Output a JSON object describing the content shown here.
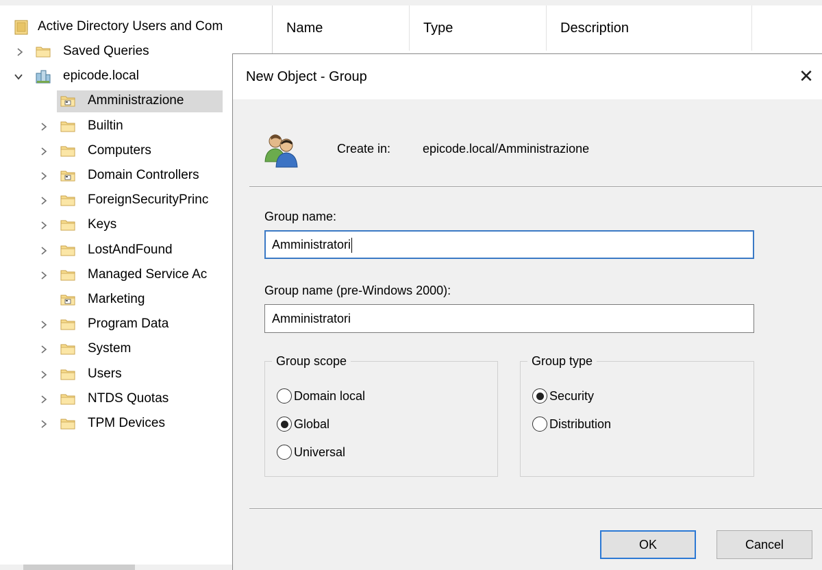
{
  "tree": {
    "root_label": "Active Directory Users and Com",
    "items": [
      {
        "label": "Saved Queries",
        "level": 1,
        "expand": "collapsed",
        "icon": "folder-icon"
      },
      {
        "label": "epicode.local",
        "level": 1,
        "expand": "expanded",
        "icon": "domain-icon"
      },
      {
        "label": "Amministrazione",
        "level": 2,
        "expand": "none",
        "icon": "ou-folder-icon",
        "selected": true
      },
      {
        "label": "Builtin",
        "level": 2,
        "expand": "collapsed",
        "icon": "folder-icon"
      },
      {
        "label": "Computers",
        "level": 2,
        "expand": "collapsed",
        "icon": "folder-icon"
      },
      {
        "label": "Domain Controllers",
        "level": 2,
        "expand": "collapsed",
        "icon": "ou-folder-icon"
      },
      {
        "label": "ForeignSecurityPrinc",
        "level": 2,
        "expand": "collapsed",
        "icon": "folder-icon"
      },
      {
        "label": "Keys",
        "level": 2,
        "expand": "collapsed",
        "icon": "folder-icon"
      },
      {
        "label": "LostAndFound",
        "level": 2,
        "expand": "collapsed",
        "icon": "folder-icon"
      },
      {
        "label": "Managed Service Ac",
        "level": 2,
        "expand": "collapsed",
        "icon": "folder-icon"
      },
      {
        "label": "Marketing",
        "level": 2,
        "expand": "none",
        "icon": "ou-folder-icon"
      },
      {
        "label": "Program Data",
        "level": 2,
        "expand": "collapsed",
        "icon": "folder-icon"
      },
      {
        "label": "System",
        "level": 2,
        "expand": "collapsed",
        "icon": "folder-icon"
      },
      {
        "label": "Users",
        "level": 2,
        "expand": "collapsed",
        "icon": "folder-icon"
      },
      {
        "label": "NTDS Quotas",
        "level": 2,
        "expand": "collapsed",
        "icon": "folder-icon"
      },
      {
        "label": "TPM Devices",
        "level": 2,
        "expand": "collapsed",
        "icon": "folder-icon"
      }
    ]
  },
  "list": {
    "columns": [
      "Name",
      "Type",
      "Description",
      ""
    ]
  },
  "dialog": {
    "title": "New Object - Group",
    "close_glyph": "✕",
    "create_in_label": "Create in:",
    "create_in_value": "epicode.local/Amministrazione",
    "group_name_label": "Group name:",
    "group_name_value": "Amministratori",
    "group_name_pre2000_label": "Group name (pre-Windows 2000):",
    "group_name_pre2000_value": "Amministratori",
    "scope": {
      "title": "Group scope",
      "options": [
        "Domain local",
        "Global",
        "Universal"
      ],
      "selected": "Global"
    },
    "type": {
      "title": "Group type",
      "options": [
        "Security",
        "Distribution"
      ],
      "selected": "Security"
    },
    "ok_label": "OK",
    "cancel_label": "Cancel"
  },
  "colors": {
    "accent": "#2b78d4",
    "selection": "#d9d9d9",
    "dialog_bg": "#f0f0f0",
    "folder": "#f4d78b"
  }
}
